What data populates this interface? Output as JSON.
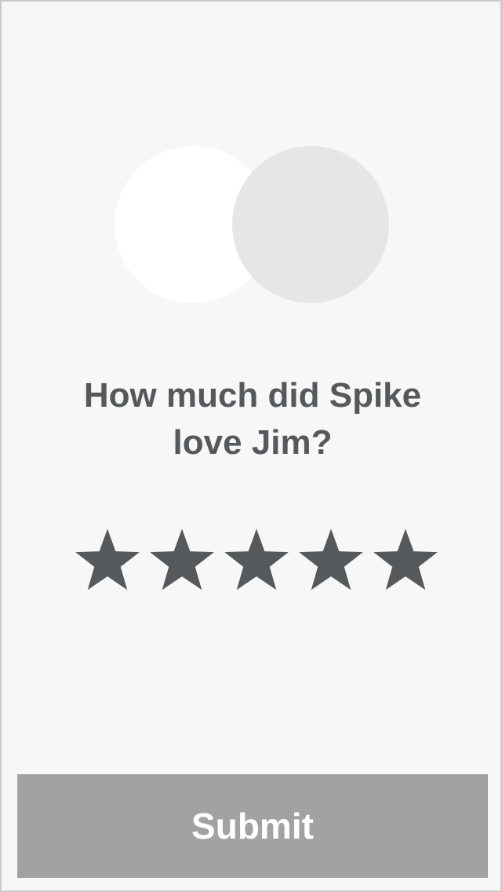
{
  "question": {
    "line1": "How much did Spike",
    "line2": "love Jim?"
  },
  "rating": {
    "max": 5,
    "value": 5,
    "star_icon": "star-icon",
    "filled_color": "#55595c"
  },
  "submit": {
    "label": "Submit",
    "background": "#a2a2a2"
  }
}
